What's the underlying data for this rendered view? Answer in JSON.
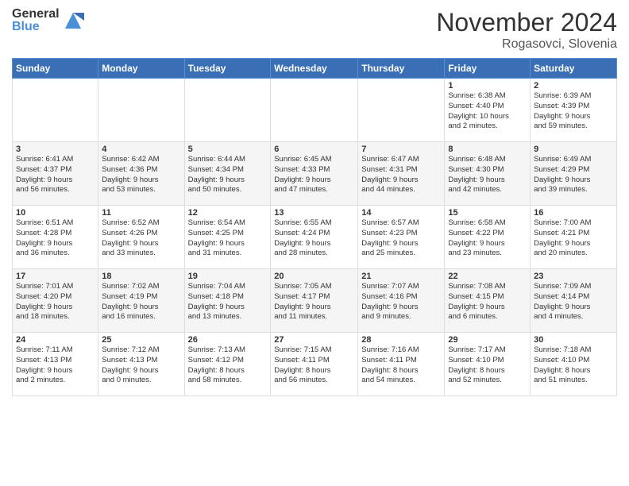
{
  "header": {
    "logo": {
      "general": "General",
      "blue": "Blue"
    },
    "title": "November 2024",
    "location": "Rogasovci, Slovenia"
  },
  "calendar": {
    "weekdays": [
      "Sunday",
      "Monday",
      "Tuesday",
      "Wednesday",
      "Thursday",
      "Friday",
      "Saturday"
    ],
    "weeks": [
      [
        {
          "day": "",
          "info": ""
        },
        {
          "day": "",
          "info": ""
        },
        {
          "day": "",
          "info": ""
        },
        {
          "day": "",
          "info": ""
        },
        {
          "day": "",
          "info": ""
        },
        {
          "day": "1",
          "info": "Sunrise: 6:38 AM\nSunset: 4:40 PM\nDaylight: 10 hours\nand 2 minutes."
        },
        {
          "day": "2",
          "info": "Sunrise: 6:39 AM\nSunset: 4:39 PM\nDaylight: 9 hours\nand 59 minutes."
        }
      ],
      [
        {
          "day": "3",
          "info": "Sunrise: 6:41 AM\nSunset: 4:37 PM\nDaylight: 9 hours\nand 56 minutes."
        },
        {
          "day": "4",
          "info": "Sunrise: 6:42 AM\nSunset: 4:36 PM\nDaylight: 9 hours\nand 53 minutes."
        },
        {
          "day": "5",
          "info": "Sunrise: 6:44 AM\nSunset: 4:34 PM\nDaylight: 9 hours\nand 50 minutes."
        },
        {
          "day": "6",
          "info": "Sunrise: 6:45 AM\nSunset: 4:33 PM\nDaylight: 9 hours\nand 47 minutes."
        },
        {
          "day": "7",
          "info": "Sunrise: 6:47 AM\nSunset: 4:31 PM\nDaylight: 9 hours\nand 44 minutes."
        },
        {
          "day": "8",
          "info": "Sunrise: 6:48 AM\nSunset: 4:30 PM\nDaylight: 9 hours\nand 42 minutes."
        },
        {
          "day": "9",
          "info": "Sunrise: 6:49 AM\nSunset: 4:29 PM\nDaylight: 9 hours\nand 39 minutes."
        }
      ],
      [
        {
          "day": "10",
          "info": "Sunrise: 6:51 AM\nSunset: 4:28 PM\nDaylight: 9 hours\nand 36 minutes."
        },
        {
          "day": "11",
          "info": "Sunrise: 6:52 AM\nSunset: 4:26 PM\nDaylight: 9 hours\nand 33 minutes."
        },
        {
          "day": "12",
          "info": "Sunrise: 6:54 AM\nSunset: 4:25 PM\nDaylight: 9 hours\nand 31 minutes."
        },
        {
          "day": "13",
          "info": "Sunrise: 6:55 AM\nSunset: 4:24 PM\nDaylight: 9 hours\nand 28 minutes."
        },
        {
          "day": "14",
          "info": "Sunrise: 6:57 AM\nSunset: 4:23 PM\nDaylight: 9 hours\nand 25 minutes."
        },
        {
          "day": "15",
          "info": "Sunrise: 6:58 AM\nSunset: 4:22 PM\nDaylight: 9 hours\nand 23 minutes."
        },
        {
          "day": "16",
          "info": "Sunrise: 7:00 AM\nSunset: 4:21 PM\nDaylight: 9 hours\nand 20 minutes."
        }
      ],
      [
        {
          "day": "17",
          "info": "Sunrise: 7:01 AM\nSunset: 4:20 PM\nDaylight: 9 hours\nand 18 minutes."
        },
        {
          "day": "18",
          "info": "Sunrise: 7:02 AM\nSunset: 4:19 PM\nDaylight: 9 hours\nand 16 minutes."
        },
        {
          "day": "19",
          "info": "Sunrise: 7:04 AM\nSunset: 4:18 PM\nDaylight: 9 hours\nand 13 minutes."
        },
        {
          "day": "20",
          "info": "Sunrise: 7:05 AM\nSunset: 4:17 PM\nDaylight: 9 hours\nand 11 minutes."
        },
        {
          "day": "21",
          "info": "Sunrise: 7:07 AM\nSunset: 4:16 PM\nDaylight: 9 hours\nand 9 minutes."
        },
        {
          "day": "22",
          "info": "Sunrise: 7:08 AM\nSunset: 4:15 PM\nDaylight: 9 hours\nand 6 minutes."
        },
        {
          "day": "23",
          "info": "Sunrise: 7:09 AM\nSunset: 4:14 PM\nDaylight: 9 hours\nand 4 minutes."
        }
      ],
      [
        {
          "day": "24",
          "info": "Sunrise: 7:11 AM\nSunset: 4:13 PM\nDaylight: 9 hours\nand 2 minutes."
        },
        {
          "day": "25",
          "info": "Sunrise: 7:12 AM\nSunset: 4:13 PM\nDaylight: 9 hours\nand 0 minutes."
        },
        {
          "day": "26",
          "info": "Sunrise: 7:13 AM\nSunset: 4:12 PM\nDaylight: 8 hours\nand 58 minutes."
        },
        {
          "day": "27",
          "info": "Sunrise: 7:15 AM\nSunset: 4:11 PM\nDaylight: 8 hours\nand 56 minutes."
        },
        {
          "day": "28",
          "info": "Sunrise: 7:16 AM\nSunset: 4:11 PM\nDaylight: 8 hours\nand 54 minutes."
        },
        {
          "day": "29",
          "info": "Sunrise: 7:17 AM\nSunset: 4:10 PM\nDaylight: 8 hours\nand 52 minutes."
        },
        {
          "day": "30",
          "info": "Sunrise: 7:18 AM\nSunset: 4:10 PM\nDaylight: 8 hours\nand 51 minutes."
        }
      ]
    ]
  }
}
